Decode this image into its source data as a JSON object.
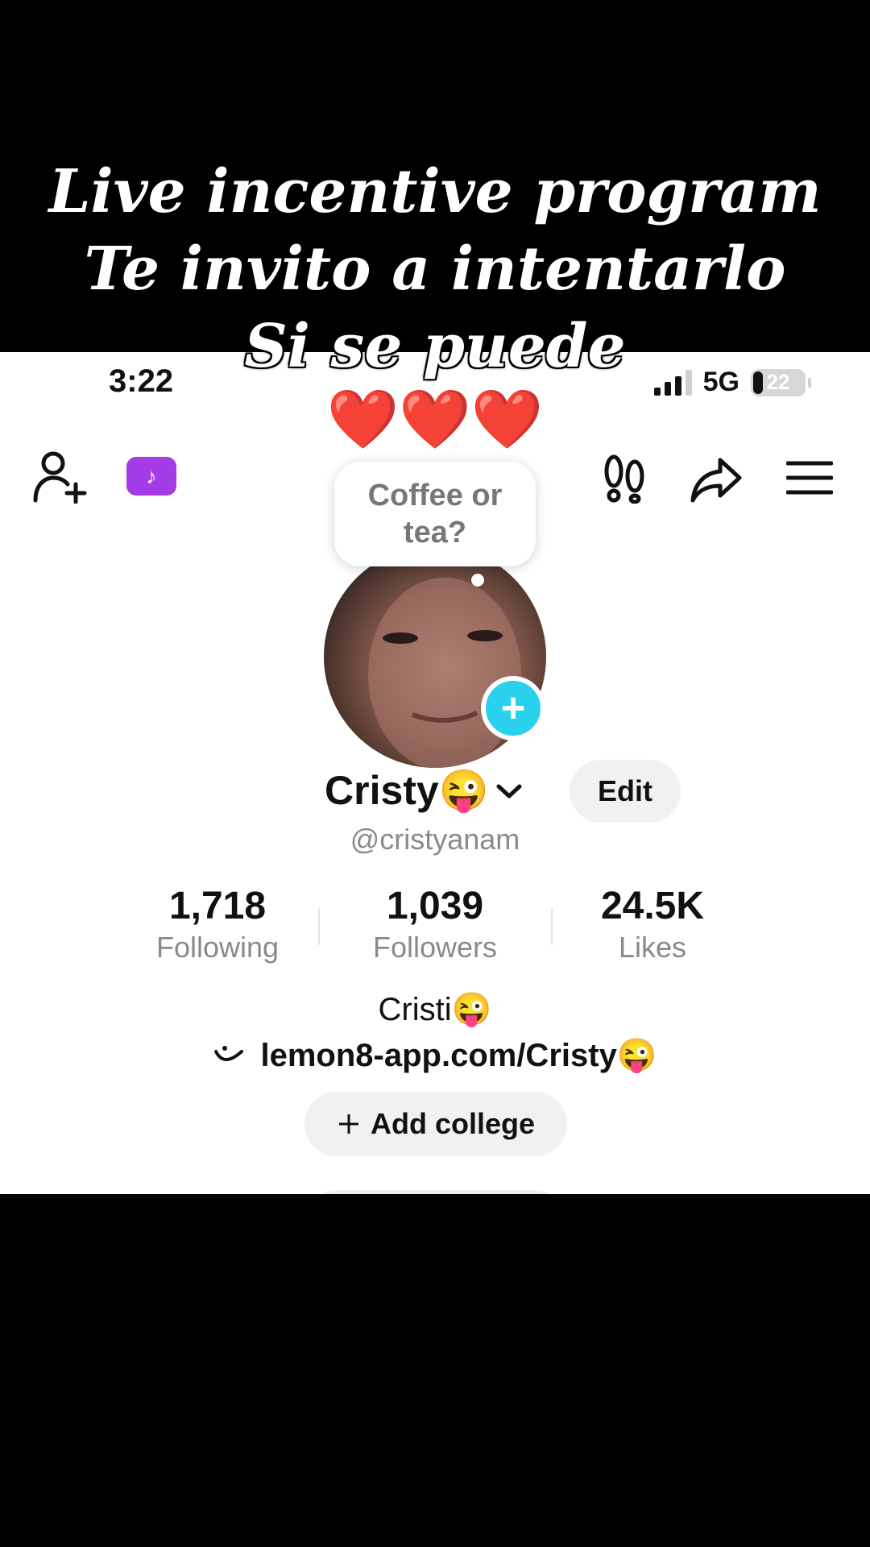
{
  "overlay": {
    "lines": [
      "Live incentive program",
      "Te invito a intentarlo",
      "Si se puede"
    ],
    "hearts": "❤️❤️❤️"
  },
  "status_bar": {
    "time": "3:22",
    "network": "5G",
    "battery": "22"
  },
  "header": {
    "add_friend_icon": "person-add-icon",
    "tiktok_studio_icon": "tiktok-note-icon",
    "footprints_icon": "footprints-icon",
    "share_icon": "share-arrow-icon",
    "menu_icon": "hamburger-menu-icon"
  },
  "profile": {
    "note": "Coffee or tea?",
    "add_story": "+",
    "name": "Cristy😜",
    "edit_label": "Edit",
    "handle": "@cristyanam",
    "stats": [
      {
        "value": "1,718",
        "label": "Following"
      },
      {
        "value": "1,039",
        "label": "Followers"
      },
      {
        "value": "24.5K",
        "label": "Likes"
      }
    ],
    "bio": "Cristi😜",
    "link": "lemon8-app.com/Cristy😜",
    "add_college": "Add college"
  }
}
